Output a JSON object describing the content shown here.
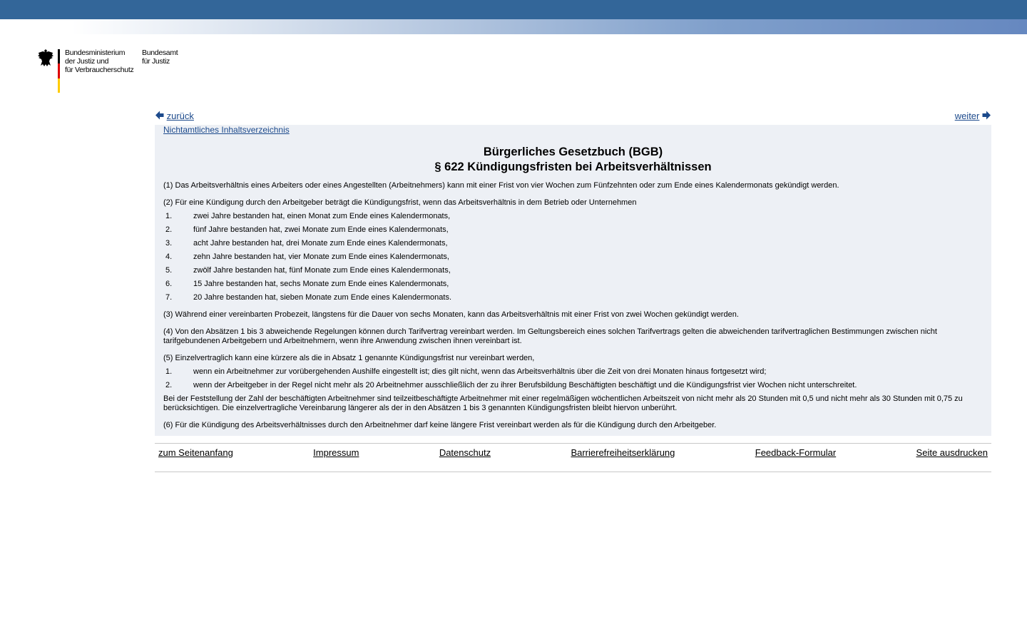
{
  "header": {
    "ministry_line1": "Bundesministerium",
    "ministry_line2": "der Justiz und",
    "ministry_line3": "für Verbraucherschutz",
    "bfj_line1": "Bundesamt",
    "bfj_line2": "für Justiz",
    "colors": {
      "topbar": "#336699",
      "flag_black": "#000000",
      "flag_red": "#dd0000",
      "flag_gold": "#ffcc00"
    }
  },
  "nav": {
    "prev_label": "zurück",
    "next_label": "weiter",
    "toc_label": "Nichtamtliches Inhaltsverzeichnis"
  },
  "title": {
    "line1": "Bürgerliches Gesetzbuch (BGB)",
    "line2": "§ 622 Kündigungsfristen bei Arbeitsverhältnissen"
  },
  "content": {
    "p1": "(1) Das Arbeitsverhältnis eines Arbeiters oder eines Angestellten (Arbeitnehmers) kann mit einer Frist von vier Wochen zum Fünfzehnten oder zum Ende eines Kalendermonats gekündigt werden.",
    "p2": "(2) Für eine Kündigung durch den Arbeitgeber beträgt die Kündigungsfrist, wenn das Arbeitsverhältnis in dem Betrieb oder Unternehmen",
    "p2_items": [
      {
        "num": "1.",
        "text": "zwei Jahre bestanden hat, einen Monat zum Ende eines Kalendermonats,"
      },
      {
        "num": "2.",
        "text": "fünf Jahre bestanden hat, zwei Monate zum Ende eines Kalendermonats,"
      },
      {
        "num": "3.",
        "text": "acht Jahre bestanden hat, drei Monate zum Ende eines Kalendermonats,"
      },
      {
        "num": "4.",
        "text": "zehn Jahre bestanden hat, vier Monate zum Ende eines Kalendermonats,"
      },
      {
        "num": "5.",
        "text": "zwölf Jahre bestanden hat, fünf Monate zum Ende eines Kalendermonats,"
      },
      {
        "num": "6.",
        "text": "15 Jahre bestanden hat, sechs Monate zum Ende eines Kalendermonats,"
      },
      {
        "num": "7.",
        "text": "20 Jahre bestanden hat, sieben Monate zum Ende eines Kalendermonats."
      }
    ],
    "p3": "(3) Während einer vereinbarten Probezeit, längstens für die Dauer von sechs Monaten, kann das Arbeitsverhältnis mit einer Frist von zwei Wochen gekündigt werden.",
    "p4": "(4) Von den Absätzen 1 bis 3 abweichende Regelungen können durch Tarifvertrag vereinbart werden. Im Geltungsbereich eines solchen Tarifvertrags gelten die abweichenden tarifvertraglichen Bestimmungen zwischen nicht tarifgebundenen Arbeitgebern und Arbeitnehmern, wenn ihre Anwendung zwischen ihnen vereinbart ist.",
    "p5": "(5) Einzelvertraglich kann eine kürzere als die in Absatz 1 genannte Kündigungsfrist nur vereinbart werden,",
    "p5_items": [
      {
        "num": "1.",
        "text": "wenn ein Arbeitnehmer zur vorübergehenden Aushilfe eingestellt ist; dies gilt nicht, wenn das Arbeitsverhältnis über die Zeit von drei Monaten hinaus fortgesetzt wird;"
      },
      {
        "num": "2.",
        "text": "wenn der Arbeitgeber in der Regel nicht mehr als 20 Arbeitnehmer ausschließlich der zu ihrer Berufsbildung Beschäftigten beschäftigt und die Kündigungsfrist vier Wochen nicht unterschreitet."
      }
    ],
    "p5_tail": "Bei der Feststellung der Zahl der beschäftigten Arbeitnehmer sind teilzeitbeschäftigte Arbeitnehmer mit einer regelmäßigen wöchentlichen Arbeitszeit von nicht mehr als 20 Stunden mit 0,5 und nicht mehr als 30 Stunden mit 0,75 zu berücksichtigen. Die einzelvertragliche Vereinbarung längerer als der in den Absätzen 1 bis 3 genannten Kündigungsfristen bleibt hiervon unberührt.",
    "p6": "(6) Für die Kündigung des Arbeitsverhältnisses durch den Arbeitnehmer darf keine längere Frist vereinbart werden als für die Kündigung durch den Arbeitgeber."
  },
  "footer": {
    "top_label": "zum Seitenanfang",
    "impressum_label": "Impressum",
    "datenschutz_label": "Datenschutz",
    "barriere_label": "Barrierefreiheitserklärung",
    "feedback_label": "Feedback-Formular",
    "print_label": "Seite ausdrucken"
  }
}
